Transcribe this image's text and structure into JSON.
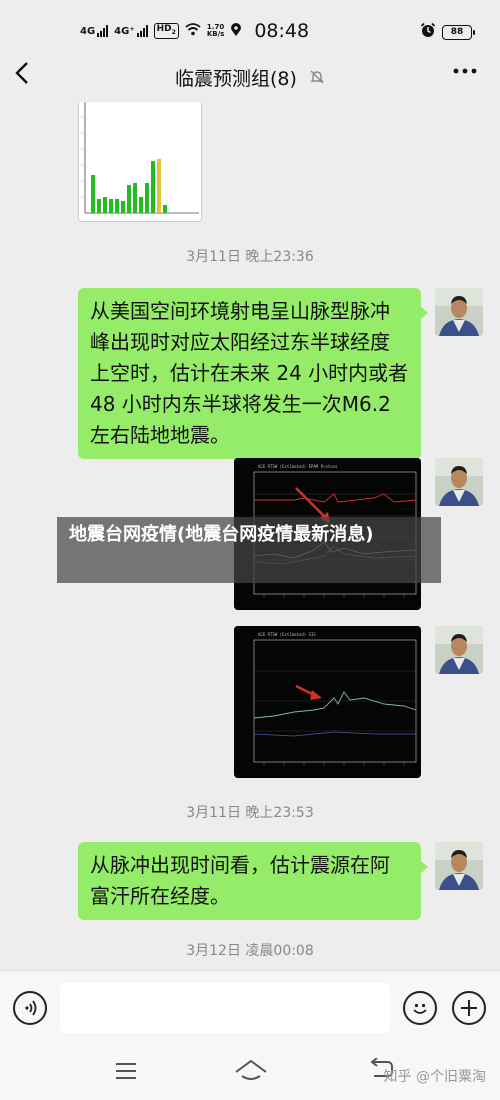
{
  "status_bar": {
    "net1": "4G",
    "net2": "4G⁺",
    "hd": "HD",
    "hd_sub": "2",
    "speed_value": "1.70",
    "speed_unit": "KB/s",
    "time": "08:48",
    "battery": "88"
  },
  "header": {
    "title": "临震预测组(8)",
    "back_icon": "chevron-left-icon",
    "mute_icon": "bell-off-icon",
    "more_icon": "more-dots-icon"
  },
  "messages": {
    "ts1": "3月11日 晚上23:36",
    "msg1": "从美国空间环境射电呈山脉型脉冲峰出现时对应太阳经过东半球经度上空时，估计在未来 24 小时内或者 48 小时内东半球将发生一次M6.2 左右陆地地震。",
    "ts2": "3月11日 晚上23:53",
    "msg2": "从脉冲出现时间看，估计震源在阿富汗所在经度。",
    "ts3": "3月12日 凌晨00:08"
  },
  "overlay": {
    "text": "地震台网疫情(地震台网疫情最新消息)"
  },
  "input_bar": {
    "voice_icon": "voice-icon",
    "emoji_icon": "emoji-icon",
    "plus_icon": "plus-icon"
  },
  "system_nav": {
    "menu_icon": "menu-icon",
    "home_icon": "home-icon",
    "back_icon": "back-icon",
    "watermark": "知乎 @个旧粟淘"
  },
  "colors": {
    "bubble": "#95ec69",
    "background": "#ededed",
    "signal_red": "#d0302a"
  }
}
